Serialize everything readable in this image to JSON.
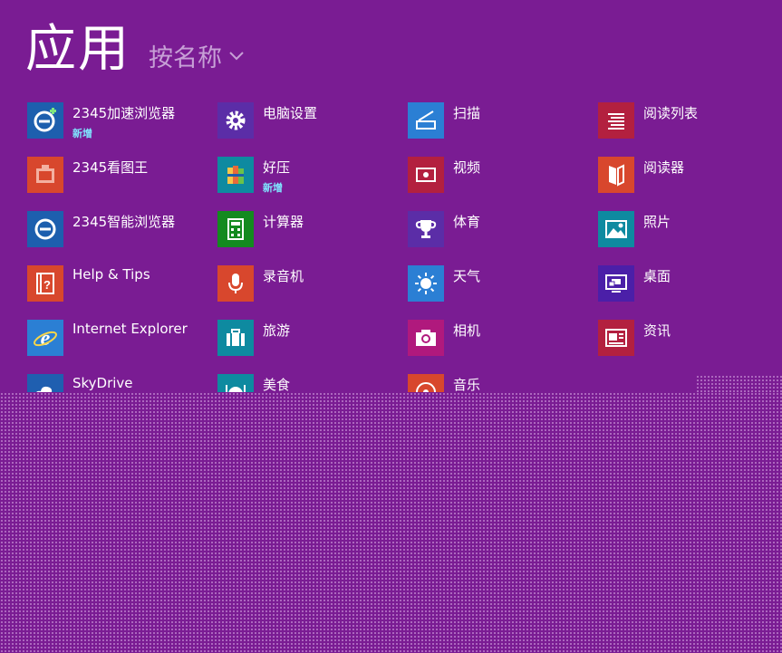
{
  "header": {
    "title": "应用",
    "sort_label": "按名称"
  },
  "colors": {
    "background": "#7a1c93",
    "accent_text": "#c7a0d6",
    "badge": "#7fe6ff"
  },
  "apps": [
    {
      "label": "2345加速浏览器",
      "badge": "新增",
      "icon": "browser-plus-icon",
      "color": "#1d5fae"
    },
    {
      "label": "2345看图王",
      "badge": "",
      "icon": "photo-viewer-icon",
      "color": "#d8472d"
    },
    {
      "label": "2345智能浏览器",
      "badge": "",
      "icon": "browser-icon",
      "color": "#1d5fae"
    },
    {
      "label": "Help & Tips",
      "badge": "",
      "icon": "help-book-icon",
      "color": "#d8472d"
    },
    {
      "label": "Internet Explorer",
      "badge": "",
      "icon": "ie-icon",
      "color": "#2b7fd4"
    },
    {
      "label": "SkyDrive",
      "badge": "",
      "icon": "cloud-icon",
      "color": "#1f5fb0"
    },
    {
      "label": "电脑设置",
      "badge": "",
      "icon": "gear-icon",
      "color": "#5b2da7"
    },
    {
      "label": "好压",
      "badge": "新增",
      "icon": "archive-books-icon",
      "color": "#0e8aa0"
    },
    {
      "label": "计算器",
      "badge": "",
      "icon": "calculator-icon",
      "color": "#138a1f"
    },
    {
      "label": "录音机",
      "badge": "",
      "icon": "microphone-icon",
      "color": "#d8472d"
    },
    {
      "label": "旅游",
      "badge": "",
      "icon": "suitcase-icon",
      "color": "#0e8aa0"
    },
    {
      "label": "美食",
      "badge": "",
      "icon": "food-icon",
      "color": "#0e8aa0"
    },
    {
      "label": "扫描",
      "badge": "",
      "icon": "scanner-icon",
      "color": "#2b7fd4"
    },
    {
      "label": "视频",
      "badge": "",
      "icon": "video-icon",
      "color": "#b3203f"
    },
    {
      "label": "体育",
      "badge": "",
      "icon": "trophy-icon",
      "color": "#5b2da7"
    },
    {
      "label": "天气",
      "badge": "",
      "icon": "sun-icon",
      "color": "#2b7fd4"
    },
    {
      "label": "相机",
      "badge": "",
      "icon": "camera-icon",
      "color": "#b0197d"
    },
    {
      "label": "音乐",
      "badge": "",
      "icon": "music-icon",
      "color": "#d8472d"
    },
    {
      "label": "阅读列表",
      "badge": "",
      "icon": "reading-list-icon",
      "color": "#b3203f"
    },
    {
      "label": "阅读器",
      "badge": "",
      "icon": "reader-icon",
      "color": "#d8472d"
    },
    {
      "label": "照片",
      "badge": "",
      "icon": "photos-icon",
      "color": "#0e8aa0"
    },
    {
      "label": "桌面",
      "badge": "",
      "icon": "desktop-icon",
      "color": "#4b1fa8"
    },
    {
      "label": "资讯",
      "badge": "",
      "icon": "news-icon",
      "color": "#b3203f"
    }
  ]
}
